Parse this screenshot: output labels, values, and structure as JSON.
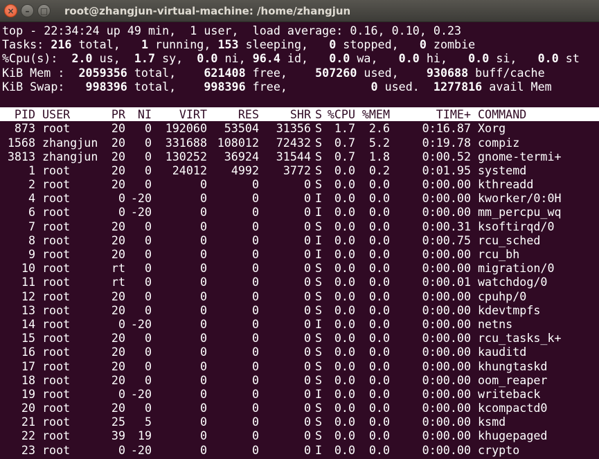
{
  "window": {
    "title": "root@zhangjun-virtual-machine: /home/zhangjun",
    "close_glyph": "×",
    "min_glyph": "–",
    "max_glyph": "□"
  },
  "summary": {
    "top_line": "top - 22:34:24 up 49 min,  1 user,  load average: 0.16, 0.10, 0.23",
    "tasks": {
      "label": "Tasks:",
      "total": "216",
      "t1": " total,   ",
      "running": "1",
      "t2": " running, ",
      "sleeping": "153",
      "t3": " sleeping,   ",
      "stopped": "0",
      "t4": " stopped,   ",
      "zombie": "0",
      "t5": " zombie"
    },
    "cpu": {
      "label": "%Cpu(s): ",
      "us": " 2.0",
      "t1": " us, ",
      "sy": " 1.7",
      "t2": " sy, ",
      "ni": " 0.0",
      "t3": " ni, ",
      "id": "96.4",
      "t4": " id,  ",
      "wa": " 0.0",
      "t5": " wa,  ",
      "hi": " 0.0",
      "t6": " hi,  ",
      "si": " 0.0",
      "t7": " si,  ",
      "st": " 0.0",
      "t8": " st"
    },
    "mem": {
      "label": "KiB Mem : ",
      "total": " 2059356",
      "t1": " total,   ",
      "free": " 621408",
      "t2": " free,   ",
      "used": " 507260",
      "t3": " used,   ",
      "buff": " 930688",
      "t4": " buff/cache"
    },
    "swap": {
      "label": "KiB Swap:  ",
      "total": " 998396",
      "t1": " total,   ",
      "free": " 998396",
      "t2": " free,        ",
      "used": "    0",
      "t3": " used.  ",
      "avail": "1277816",
      "t4": " avail Mem"
    }
  },
  "columns": {
    "pid": "PID",
    "user": "USER",
    "pr": "PR",
    "ni": "NI",
    "virt": "VIRT",
    "res": "RES",
    "shr": "SHR",
    "s": "S",
    "cpu": "%CPU",
    "mem": "%MEM",
    "time": "TIME+",
    "cmd": "COMMAND"
  },
  "processes": [
    {
      "pid": "873",
      "user": "root",
      "pr": "20",
      "ni": "0",
      "virt": "192060",
      "res": "53504",
      "shr": "31356",
      "s": "S",
      "cpu": "1.7",
      "mem": "2.6",
      "time": "0:16.87",
      "cmd": "Xorg"
    },
    {
      "pid": "1568",
      "user": "zhangjun",
      "pr": "20",
      "ni": "0",
      "virt": "331688",
      "res": "108012",
      "shr": "72432",
      "s": "S",
      "cpu": "0.7",
      "mem": "5.2",
      "time": "0:19.78",
      "cmd": "compiz"
    },
    {
      "pid": "3813",
      "user": "zhangjun",
      "pr": "20",
      "ni": "0",
      "virt": "130252",
      "res": "36924",
      "shr": "31544",
      "s": "S",
      "cpu": "0.7",
      "mem": "1.8",
      "time": "0:00.52",
      "cmd": "gnome-termi+"
    },
    {
      "pid": "1",
      "user": "root",
      "pr": "20",
      "ni": "0",
      "virt": "24012",
      "res": "4992",
      "shr": "3772",
      "s": "S",
      "cpu": "0.0",
      "mem": "0.2",
      "time": "0:01.95",
      "cmd": "systemd"
    },
    {
      "pid": "2",
      "user": "root",
      "pr": "20",
      "ni": "0",
      "virt": "0",
      "res": "0",
      "shr": "0",
      "s": "S",
      "cpu": "0.0",
      "mem": "0.0",
      "time": "0:00.00",
      "cmd": "kthreadd"
    },
    {
      "pid": "4",
      "user": "root",
      "pr": "0",
      "ni": "-20",
      "virt": "0",
      "res": "0",
      "shr": "0",
      "s": "I",
      "cpu": "0.0",
      "mem": "0.0",
      "time": "0:00.00",
      "cmd": "kworker/0:0H"
    },
    {
      "pid": "6",
      "user": "root",
      "pr": "0",
      "ni": "-20",
      "virt": "0",
      "res": "0",
      "shr": "0",
      "s": "I",
      "cpu": "0.0",
      "mem": "0.0",
      "time": "0:00.00",
      "cmd": "mm_percpu_wq"
    },
    {
      "pid": "7",
      "user": "root",
      "pr": "20",
      "ni": "0",
      "virt": "0",
      "res": "0",
      "shr": "0",
      "s": "S",
      "cpu": "0.0",
      "mem": "0.0",
      "time": "0:00.31",
      "cmd": "ksoftirqd/0"
    },
    {
      "pid": "8",
      "user": "root",
      "pr": "20",
      "ni": "0",
      "virt": "0",
      "res": "0",
      "shr": "0",
      "s": "I",
      "cpu": "0.0",
      "mem": "0.0",
      "time": "0:00.75",
      "cmd": "rcu_sched"
    },
    {
      "pid": "9",
      "user": "root",
      "pr": "20",
      "ni": "0",
      "virt": "0",
      "res": "0",
      "shr": "0",
      "s": "I",
      "cpu": "0.0",
      "mem": "0.0",
      "time": "0:00.00",
      "cmd": "rcu_bh"
    },
    {
      "pid": "10",
      "user": "root",
      "pr": "rt",
      "ni": "0",
      "virt": "0",
      "res": "0",
      "shr": "0",
      "s": "S",
      "cpu": "0.0",
      "mem": "0.0",
      "time": "0:00.00",
      "cmd": "migration/0"
    },
    {
      "pid": "11",
      "user": "root",
      "pr": "rt",
      "ni": "0",
      "virt": "0",
      "res": "0",
      "shr": "0",
      "s": "S",
      "cpu": "0.0",
      "mem": "0.0",
      "time": "0:00.01",
      "cmd": "watchdog/0"
    },
    {
      "pid": "12",
      "user": "root",
      "pr": "20",
      "ni": "0",
      "virt": "0",
      "res": "0",
      "shr": "0",
      "s": "S",
      "cpu": "0.0",
      "mem": "0.0",
      "time": "0:00.00",
      "cmd": "cpuhp/0"
    },
    {
      "pid": "13",
      "user": "root",
      "pr": "20",
      "ni": "0",
      "virt": "0",
      "res": "0",
      "shr": "0",
      "s": "S",
      "cpu": "0.0",
      "mem": "0.0",
      "time": "0:00.00",
      "cmd": "kdevtmpfs"
    },
    {
      "pid": "14",
      "user": "root",
      "pr": "0",
      "ni": "-20",
      "virt": "0",
      "res": "0",
      "shr": "0",
      "s": "I",
      "cpu": "0.0",
      "mem": "0.0",
      "time": "0:00.00",
      "cmd": "netns"
    },
    {
      "pid": "15",
      "user": "root",
      "pr": "20",
      "ni": "0",
      "virt": "0",
      "res": "0",
      "shr": "0",
      "s": "S",
      "cpu": "0.0",
      "mem": "0.0",
      "time": "0:00.00",
      "cmd": "rcu_tasks_k+"
    },
    {
      "pid": "16",
      "user": "root",
      "pr": "20",
      "ni": "0",
      "virt": "0",
      "res": "0",
      "shr": "0",
      "s": "S",
      "cpu": "0.0",
      "mem": "0.0",
      "time": "0:00.00",
      "cmd": "kauditd"
    },
    {
      "pid": "17",
      "user": "root",
      "pr": "20",
      "ni": "0",
      "virt": "0",
      "res": "0",
      "shr": "0",
      "s": "S",
      "cpu": "0.0",
      "mem": "0.0",
      "time": "0:00.00",
      "cmd": "khungtaskd"
    },
    {
      "pid": "18",
      "user": "root",
      "pr": "20",
      "ni": "0",
      "virt": "0",
      "res": "0",
      "shr": "0",
      "s": "S",
      "cpu": "0.0",
      "mem": "0.0",
      "time": "0:00.00",
      "cmd": "oom_reaper"
    },
    {
      "pid": "19",
      "user": "root",
      "pr": "0",
      "ni": "-20",
      "virt": "0",
      "res": "0",
      "shr": "0",
      "s": "I",
      "cpu": "0.0",
      "mem": "0.0",
      "time": "0:00.00",
      "cmd": "writeback"
    },
    {
      "pid": "20",
      "user": "root",
      "pr": "20",
      "ni": "0",
      "virt": "0",
      "res": "0",
      "shr": "0",
      "s": "S",
      "cpu": "0.0",
      "mem": "0.0",
      "time": "0:00.00",
      "cmd": "kcompactd0"
    },
    {
      "pid": "21",
      "user": "root",
      "pr": "25",
      "ni": "5",
      "virt": "0",
      "res": "0",
      "shr": "0",
      "s": "S",
      "cpu": "0.0",
      "mem": "0.0",
      "time": "0:00.00",
      "cmd": "ksmd"
    },
    {
      "pid": "22",
      "user": "root",
      "pr": "39",
      "ni": "19",
      "virt": "0",
      "res": "0",
      "shr": "0",
      "s": "S",
      "cpu": "0.0",
      "mem": "0.0",
      "time": "0:00.00",
      "cmd": "khugepaged"
    },
    {
      "pid": "23",
      "user": "root",
      "pr": "0",
      "ni": "-20",
      "virt": "0",
      "res": "0",
      "shr": "0",
      "s": "I",
      "cpu": "0.0",
      "mem": "0.0",
      "time": "0:00.00",
      "cmd": "crypto"
    }
  ],
  "colors": {
    "terminal_bg": "#300a24",
    "foreground": "#ffffff",
    "title_text": "#dfdbd2",
    "close_button": "#e95420"
  }
}
